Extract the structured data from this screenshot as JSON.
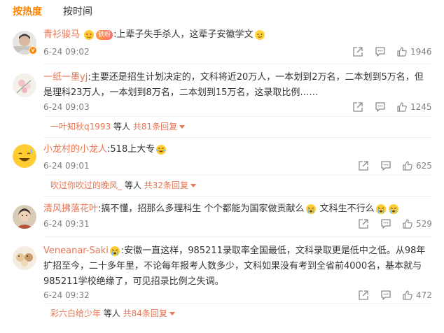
{
  "tabs": [
    {
      "label": "按热度",
      "active": true
    },
    {
      "label": "按时间",
      "active": false
    }
  ],
  "accent_color": "#ff8200",
  "username_color": "#eb7350",
  "comments": [
    {
      "user": "青衫骏马",
      "badge": "铁粉",
      "text": ":上辈子失手杀人，这辈子安徽学文",
      "time": "6-24 09:02",
      "likes": "1946",
      "emojis": [
        "smile-emoji"
      ]
    },
    {
      "user": "一纸一墨yj",
      "text": ":主要还是招生计划决定的，文科将近20万人，一本划到2万名，二本划到5万名，但是理科23万人，一本划到8万名，二本划到15万名，这录取比例……",
      "time": "6-24 09:03",
      "likes": "1245",
      "reply": {
        "user": "一叶知秋q1993",
        "middle": " 等人 ",
        "total": "共81条回复"
      }
    },
    {
      "user": "小龙村的小龙人",
      "text": ":518上大专",
      "time": "6-24 09:01",
      "likes": "625",
      "reply": {
        "user": "吹过你吹过的晚风_",
        "middle": " 等人 ",
        "total": "共32条回复"
      }
    },
    {
      "user": "清风拂落花叶",
      "text_a": ":搞不懂，招那么多理科生 个个都能为国家做贡献么",
      "text_b": " 文科生不行么",
      "time": "6-24 09:31",
      "likes": "529"
    },
    {
      "user": "Veneanar-Saki",
      "text": ":安徽一直这样，985211录取率全国最低，文科录取更是低中之低。从98年扩招至今，二十多年里，不论每年报考人数多少，文科如果没有考到全省前4000名，基本就与985211学校绝缘了，可见招录比例之失调。",
      "time": "6-24 09:32",
      "likes": "472",
      "reply": {
        "user": "彩六白给少年",
        "middle": " 等人 ",
        "total": "共84条回复"
      }
    }
  ]
}
